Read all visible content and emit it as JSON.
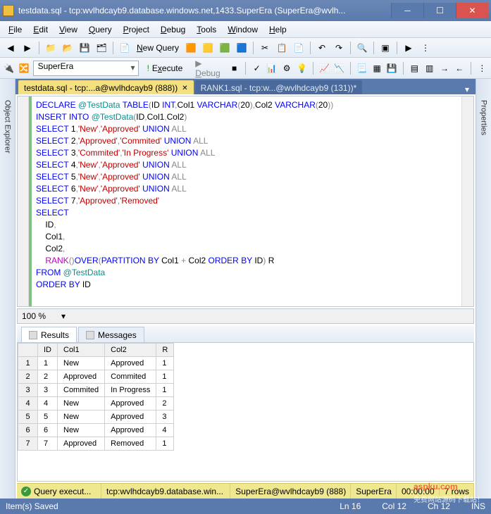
{
  "window": {
    "title": "testdata.sql - tcp:wvlhdcayb9.database.windows.net,1433.SuperEra (SuperEra@wvlh...",
    "min": "─",
    "max": "☐",
    "close": "✕"
  },
  "menu": {
    "file": "File",
    "edit": "Edit",
    "view": "View",
    "query": "Query",
    "project": "Project",
    "debug": "Debug",
    "tools": "Tools",
    "window": "Window",
    "help": "Help"
  },
  "toolbar": {
    "newquery": "New Query"
  },
  "toolbar2": {
    "db": "SuperEra",
    "execute": "Execute",
    "debug": "Debug"
  },
  "sidepanels": {
    "left": "Object Explorer",
    "right": "Properties"
  },
  "tabs": {
    "active": "testdata.sql - tcp:...a@wvlhdcayb9 (888))",
    "inactive": "RANK1.sql - tcp:w...@wvlhdcayb9 (131))*"
  },
  "code_lines": [
    [
      [
        "kw",
        "DECLARE"
      ],
      [
        "sp",
        " "
      ],
      [
        "var",
        "@TestData"
      ],
      [
        "sp",
        " "
      ],
      [
        "kw",
        "TABLE"
      ],
      [
        "op",
        "("
      ],
      [
        "id",
        "ID"
      ],
      [
        "sp",
        " "
      ],
      [
        "kw",
        "INT"
      ],
      [
        "op",
        ","
      ],
      [
        "id",
        "Col1"
      ],
      [
        "sp",
        " "
      ],
      [
        "kw",
        "VARCHAR"
      ],
      [
        "op",
        "("
      ],
      [
        "num",
        "20"
      ],
      [
        "op",
        ")"
      ],
      [
        "op",
        ","
      ],
      [
        "id",
        "Col2"
      ],
      [
        "sp",
        " "
      ],
      [
        "kw",
        "VARCHAR"
      ],
      [
        "op",
        "("
      ],
      [
        "num",
        "20"
      ],
      [
        "op",
        "))"
      ]
    ],
    [
      [
        "kw",
        "INSERT"
      ],
      [
        "sp",
        " "
      ],
      [
        "kw",
        "INTO"
      ],
      [
        "sp",
        " "
      ],
      [
        "var",
        "@TestData"
      ],
      [
        "op",
        "("
      ],
      [
        "id",
        "ID"
      ],
      [
        "op",
        ","
      ],
      [
        "id",
        "Col1"
      ],
      [
        "op",
        ","
      ],
      [
        "id",
        "Col2"
      ],
      [
        "op",
        ")"
      ]
    ],
    [
      [
        "kw",
        "SELECT"
      ],
      [
        "sp",
        " "
      ],
      [
        "num",
        "1"
      ],
      [
        "op",
        ","
      ],
      [
        "str",
        "'New'"
      ],
      [
        "op",
        ","
      ],
      [
        "str",
        "'Approved'"
      ],
      [
        "sp",
        " "
      ],
      [
        "kw",
        "UNION"
      ],
      [
        "sp",
        " "
      ],
      [
        "op",
        "ALL"
      ]
    ],
    [
      [
        "kw",
        "SELECT"
      ],
      [
        "sp",
        " "
      ],
      [
        "num",
        "2"
      ],
      [
        "op",
        ","
      ],
      [
        "str",
        "'Approved'"
      ],
      [
        "op",
        ","
      ],
      [
        "str",
        "'Commited'"
      ],
      [
        "sp",
        " "
      ],
      [
        "kw",
        "UNION"
      ],
      [
        "sp",
        " "
      ],
      [
        "op",
        "ALL"
      ]
    ],
    [
      [
        "kw",
        "SELECT"
      ],
      [
        "sp",
        " "
      ],
      [
        "num",
        "3"
      ],
      [
        "op",
        ","
      ],
      [
        "str",
        "'Commited'"
      ],
      [
        "op",
        ","
      ],
      [
        "str",
        "'In Progress'"
      ],
      [
        "sp",
        " "
      ],
      [
        "kw",
        "UNION"
      ],
      [
        "sp",
        " "
      ],
      [
        "op",
        "ALL"
      ]
    ],
    [
      [
        "kw",
        "SELECT"
      ],
      [
        "sp",
        " "
      ],
      [
        "num",
        "4"
      ],
      [
        "op",
        ","
      ],
      [
        "str",
        "'New'"
      ],
      [
        "op",
        ","
      ],
      [
        "str",
        "'Approved'"
      ],
      [
        "sp",
        " "
      ],
      [
        "kw",
        "UNION"
      ],
      [
        "sp",
        " "
      ],
      [
        "op",
        "ALL"
      ]
    ],
    [
      [
        "kw",
        "SELECT"
      ],
      [
        "sp",
        " "
      ],
      [
        "num",
        "5"
      ],
      [
        "op",
        ","
      ],
      [
        "str",
        "'New'"
      ],
      [
        "op",
        ","
      ],
      [
        "str",
        "'Approved'"
      ],
      [
        "sp",
        " "
      ],
      [
        "kw",
        "UNION"
      ],
      [
        "sp",
        " "
      ],
      [
        "op",
        "ALL"
      ]
    ],
    [
      [
        "kw",
        "SELECT"
      ],
      [
        "sp",
        " "
      ],
      [
        "num",
        "6"
      ],
      [
        "op",
        ","
      ],
      [
        "str",
        "'New'"
      ],
      [
        "op",
        ","
      ],
      [
        "str",
        "'Approved'"
      ],
      [
        "sp",
        " "
      ],
      [
        "kw",
        "UNION"
      ],
      [
        "sp",
        " "
      ],
      [
        "op",
        "ALL"
      ]
    ],
    [
      [
        "kw",
        "SELECT"
      ],
      [
        "sp",
        " "
      ],
      [
        "num",
        "7"
      ],
      [
        "op",
        ","
      ],
      [
        "str",
        "'Approved'"
      ],
      [
        "op",
        ","
      ],
      [
        "str",
        "'Removed'"
      ]
    ],
    [
      [
        "kw",
        "SELECT"
      ]
    ],
    [
      [
        "sp",
        "    "
      ],
      [
        "id",
        "ID"
      ],
      [
        "op",
        ","
      ]
    ],
    [
      [
        "sp",
        "    "
      ],
      [
        "id",
        "Col1"
      ],
      [
        "op",
        ","
      ]
    ],
    [
      [
        "sp",
        "    "
      ],
      [
        "id",
        "Col2"
      ],
      [
        "op",
        ","
      ]
    ],
    [
      [
        "sp",
        "    "
      ],
      [
        "fn",
        "RANK"
      ],
      [
        "op",
        "()"
      ],
      [
        "kw",
        "OVER"
      ],
      [
        "op",
        "("
      ],
      [
        "kw",
        "PARTITION"
      ],
      [
        "sp",
        " "
      ],
      [
        "kw",
        "BY"
      ],
      [
        "sp",
        " "
      ],
      [
        "id",
        "Col1"
      ],
      [
        "sp",
        " "
      ],
      [
        "op",
        "+"
      ],
      [
        "sp",
        " "
      ],
      [
        "id",
        "Col2"
      ],
      [
        "sp",
        " "
      ],
      [
        "kw",
        "ORDER"
      ],
      [
        "sp",
        " "
      ],
      [
        "kw",
        "BY"
      ],
      [
        "sp",
        " "
      ],
      [
        "id",
        "ID"
      ],
      [
        "op",
        ")"
      ],
      [
        "sp",
        " "
      ],
      [
        "id",
        "R"
      ]
    ],
    [
      [
        "kw",
        "FROM"
      ],
      [
        "sp",
        " "
      ],
      [
        "var",
        "@TestData"
      ]
    ],
    [
      [
        "kw",
        "ORDER"
      ],
      [
        "sp",
        " "
      ],
      [
        "kw",
        "BY"
      ],
      [
        "sp",
        " "
      ],
      [
        "id",
        "ID"
      ]
    ]
  ],
  "zoom": "100 %",
  "result_tabs": {
    "results": "Results",
    "messages": "Messages"
  },
  "grid": {
    "headers": [
      "",
      "ID",
      "Col1",
      "Col2",
      "R"
    ],
    "rows": [
      [
        "1",
        "1",
        "New",
        "Approved",
        "1"
      ],
      [
        "2",
        "2",
        "Approved",
        "Commited",
        "1"
      ],
      [
        "3",
        "3",
        "Commited",
        "In Progress",
        "1"
      ],
      [
        "4",
        "4",
        "New",
        "Approved",
        "2"
      ],
      [
        "5",
        "5",
        "New",
        "Approved",
        "3"
      ],
      [
        "6",
        "6",
        "New",
        "Approved",
        "4"
      ],
      [
        "7",
        "7",
        "Approved",
        "Removed",
        "1"
      ]
    ]
  },
  "querystatus": {
    "ok": "Query execut...",
    "server": "tcp:wvlhdcayb9.database.win...",
    "user": "SuperEra@wvlhdcayb9 (888)",
    "db": "SuperEra",
    "time": "00:00:00",
    "rows": "7 rows"
  },
  "appstatus": {
    "saved": "Item(s) Saved",
    "ln": "Ln 16",
    "col": "Col 12",
    "ch": "Ch 12",
    "ins": "INS"
  },
  "watermark": {
    "big": "aspku.com",
    "small": "免费网站源码下载站！"
  }
}
